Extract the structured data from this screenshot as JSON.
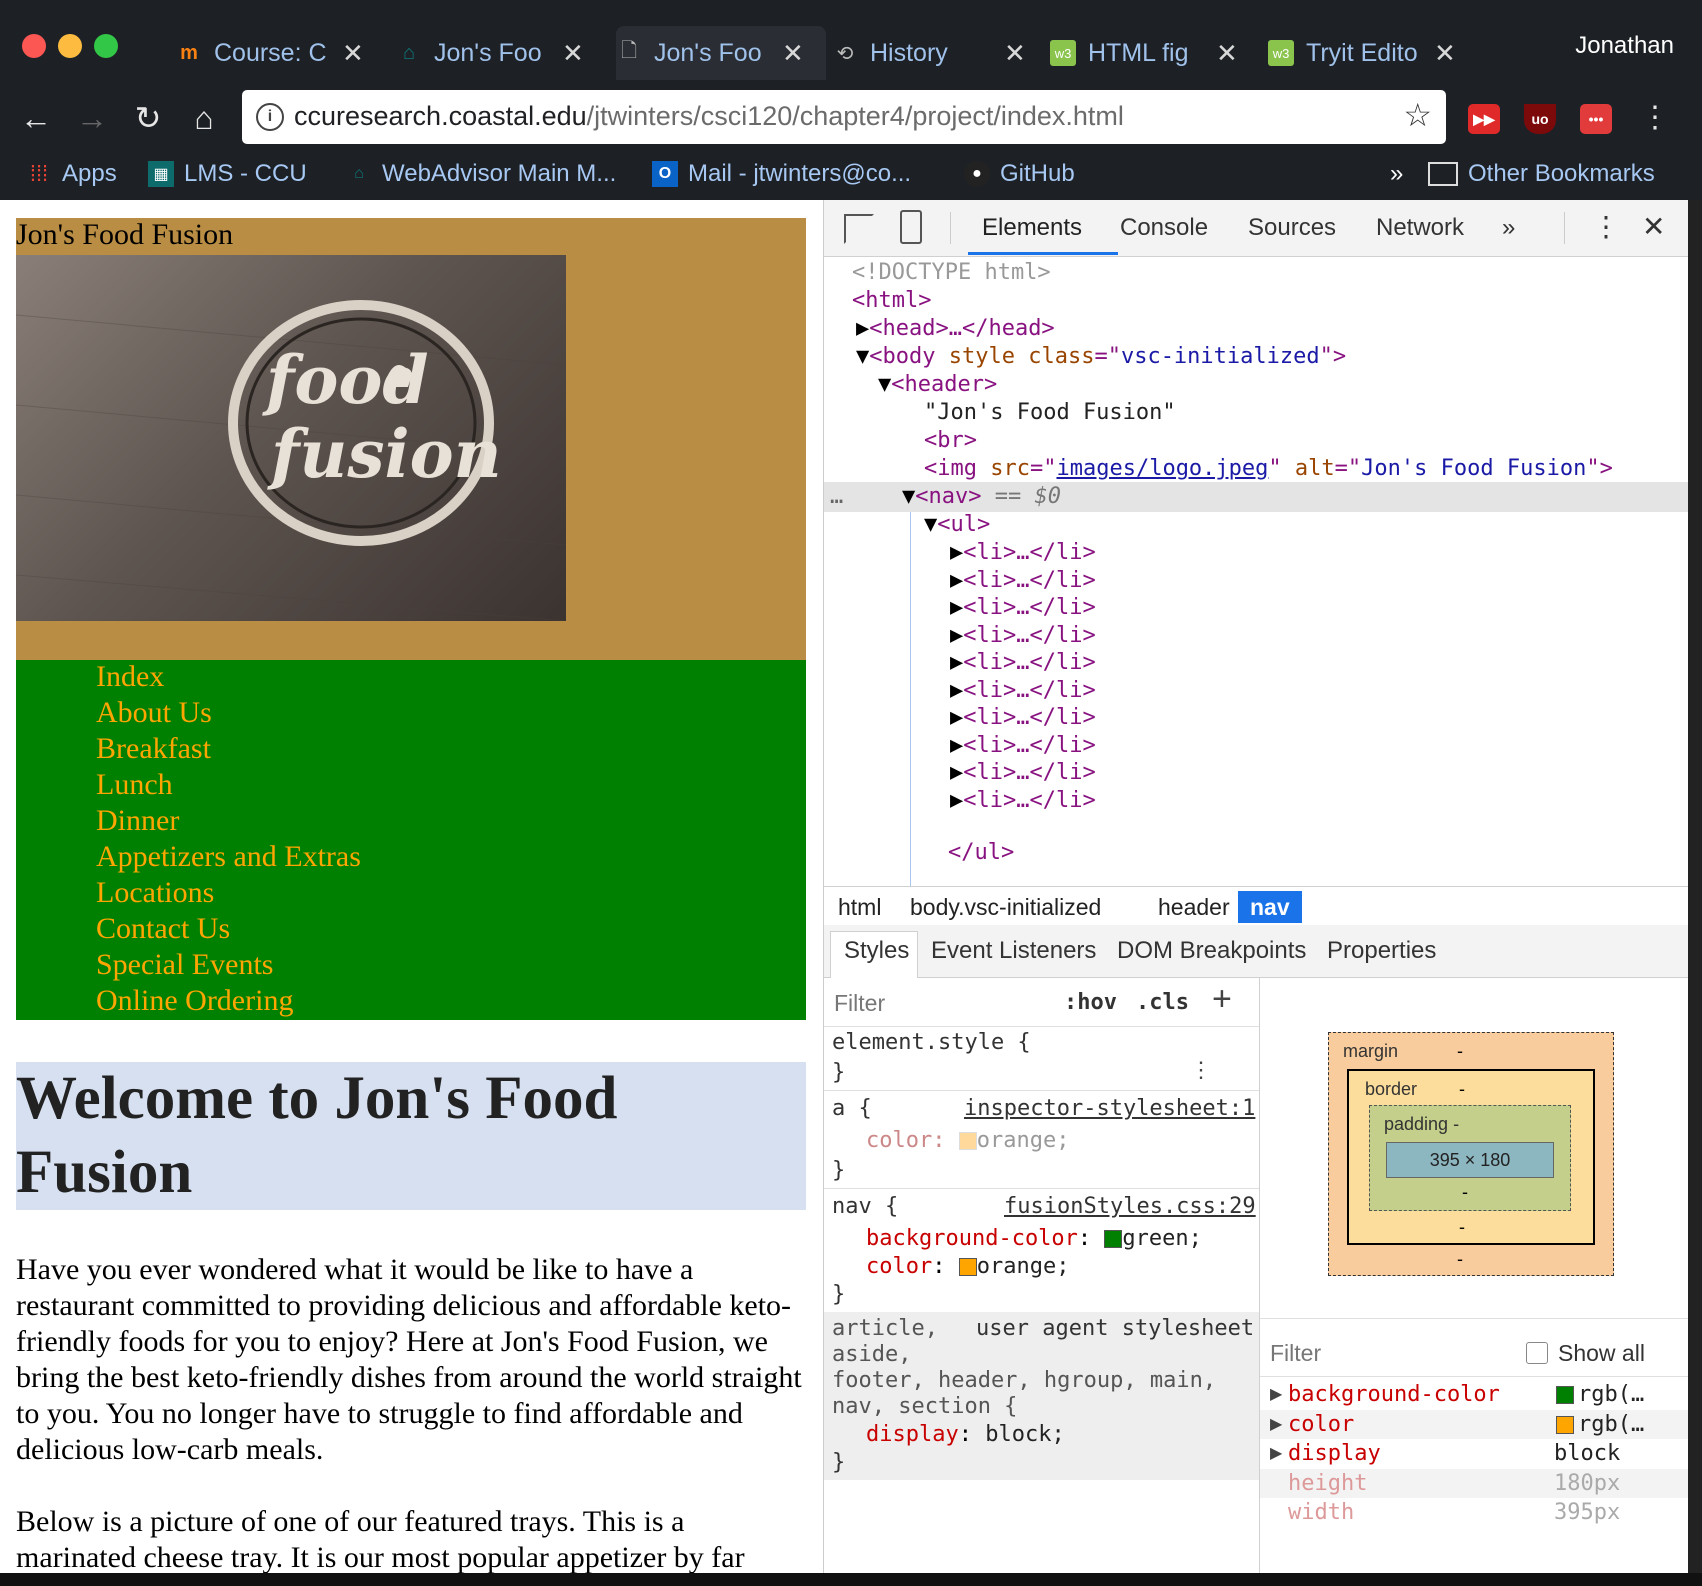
{
  "browser": {
    "tabs": [
      {
        "icon": "moodle-icon",
        "title": "Course: C"
      },
      {
        "icon": "ccu-icon",
        "title": "Jon's Foo"
      },
      {
        "icon": "page-icon",
        "title": "Jon's Foo"
      },
      {
        "icon": "history-icon",
        "title": "History"
      },
      {
        "icon": "w3-icon",
        "title": "HTML fig"
      },
      {
        "icon": "w3-icon",
        "title": "Tryit Edito"
      }
    ],
    "profile": "Jonathan",
    "url_host": "ccuresearch.coastal.edu",
    "url_path": "/jtwinters/csci120/chapter4/project/index.html",
    "bookmarks": [
      {
        "icon": "apps-icon",
        "label": "Apps"
      },
      {
        "icon": "ccu-icon",
        "label": "LMS - CCU"
      },
      {
        "icon": "ccu-icon",
        "label": "WebAdvisor Main M..."
      },
      {
        "icon": "outlook-icon",
        "label": "Mail - jtwinters@co..."
      },
      {
        "icon": "github-icon",
        "label": "GitHub"
      }
    ],
    "overflow": "»",
    "other_bookmarks": "Other Bookmarks"
  },
  "page": {
    "site_title": "Jon's Food Fusion",
    "logo_text_1": "food",
    "logo_text_2": "fusion",
    "nav_items": [
      "Index",
      "About Us",
      "Breakfast",
      "Lunch",
      "Dinner",
      "Appetizers and Extras",
      "Locations",
      "Contact Us",
      "Special Events",
      "Online Ordering"
    ],
    "heading": "Welcome to Jon's Food Fusion",
    "paragraph1": "Have you ever wondered what it would be like to have a restaurant committed to providing delicious and affordable keto-friendly foods for you to enjoy? Here at Jon's Food Fusion, we bring the best keto-friendly dishes from around the world straight to you. You no longer have to struggle to find affordable and delicious low-carb meals.",
    "paragraph2": "Below is a picture of one of our featured trays. This is a marinated cheese tray. It is our most popular appetizer by far"
  },
  "devtools": {
    "tabs": [
      "Elements",
      "Console",
      "Sources",
      "Network"
    ],
    "more": "»",
    "dom": {
      "doctype": "<!DOCTYPE html>",
      "html_open": "<html>",
      "head": "<head>…</head>",
      "body_tag": "body",
      "body_attr1": "style",
      "body_attr2": "class",
      "body_class": "vsc-initialized",
      "header_tag": "<header>",
      "header_text": "\"Jon's Food Fusion\"",
      "br": "<br>",
      "img_src": "images/logo.jpeg",
      "img_alt": "Jon's Food Fusion",
      "nav_tag": "<nav>",
      "nav_marker": "== $0",
      "ul_tag": "<ul>",
      "li": "<li>…</li>",
      "li_count_label": "10",
      "ul_close": "</ul>"
    },
    "breadcrumbs": [
      "html",
      "body.vsc-initialized",
      "header",
      "nav"
    ],
    "subtabs": [
      "Styles",
      "Event Listeners",
      "DOM Breakpoints",
      "Properties"
    ],
    "filter_placeholder": "Filter",
    "hov": ":hov",
    "cls": ".cls",
    "rules": {
      "element_style": "element.style {",
      "a_selector": "a {",
      "a_source": "inspector-stylesheet:1",
      "a_prop": "color",
      "a_val": "orange;",
      "nav_selector": "nav {",
      "nav_source": "fusionStyles.css:29",
      "nav_prop1": "background-color",
      "nav_val1": "green;",
      "nav_prop2": "color",
      "nav_val2": "orange;",
      "ua_selector_1": "article,",
      "ua_selector_2": "aside,",
      "ua_selector_3": "footer, header, hgroup, main,",
      "ua_selector_4": "nav, section {",
      "ua_source": "user agent stylesheet",
      "ua_prop": "display",
      "ua_val": "block;"
    },
    "boxmodel": {
      "margin": "margin",
      "border": "border",
      "padding": "padding -",
      "content": "395 × 180",
      "dash": "-"
    },
    "computed_filter": "Filter",
    "show_all": "Show all",
    "computed": [
      {
        "prop": "background-color",
        "val": "rgb(…",
        "swatch": "#008000"
      },
      {
        "prop": "color",
        "val": "rgb(…",
        "swatch": "#ffa500"
      },
      {
        "prop": "display",
        "val": "block",
        "swatch": ""
      },
      {
        "prop": "height",
        "val": "180px",
        "swatch": ""
      },
      {
        "prop": "width",
        "val": "395px",
        "swatch": ""
      }
    ]
  },
  "colors": {
    "header_bg": "#b98d44",
    "nav_bg": "#008000",
    "link": "#ffa500",
    "heading_bg": "#d6e0f0"
  }
}
